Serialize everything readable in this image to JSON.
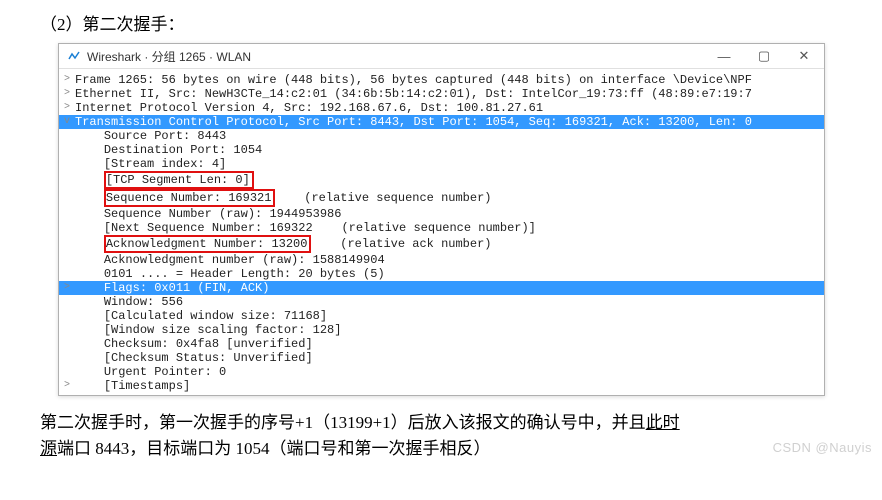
{
  "doc": {
    "header": "（2）第二次握手：",
    "footer_p1_a": "    第二次握手时，第一次握手的序号+1（13199+1）后放入该报文的确认号中，并且",
    "footer_p1_b": "此时",
    "footer_p2_a": "源",
    "footer_p2_b": "端口 8443，目标端口为 1054（端口号和第一次握手相反）"
  },
  "watermark": "CSDN @Nauyis",
  "titlebar": {
    "app": "Wireshark · 分组 1265 · WLAN",
    "min": "—",
    "max": "▢",
    "close": "✕"
  },
  "tree": [
    {
      "g": ">",
      "i": "",
      "t": "Frame 1265: 56 bytes on wire (448 bits), 56 bytes captured (448 bits) on interface \\Device\\NPF",
      "hl": false
    },
    {
      "g": ">",
      "i": "",
      "t": "Ethernet II, Src: NewH3CTe_14:c2:01 (34:6b:5b:14:c2:01), Dst: IntelCor_19:73:ff (48:89:e7:19:7",
      "hl": false
    },
    {
      "g": ">",
      "i": "",
      "t": "Internet Protocol Version 4, Src: 192.168.67.6, Dst: 100.81.27.61",
      "hl": false
    },
    {
      "g": "v",
      "i": "",
      "t": "Transmission Control Protocol, Src Port: 8443, Dst Port: 1054, Seq: 169321, Ack: 13200, Len: 0",
      "hl": true
    },
    {
      "g": "",
      "i": "    ",
      "t": "Source Port: 8443",
      "hl": false
    },
    {
      "g": "",
      "i": "    ",
      "t": "Destination Port: 1054",
      "hl": false
    },
    {
      "g": "",
      "i": "    ",
      "t": "[Stream index: 4]",
      "hl": false
    },
    {
      "g": "",
      "i": "    ",
      "t": "[TCP Segment Len: 0]",
      "hl": false,
      "box": true
    },
    {
      "g": "",
      "i": "    ",
      "t": "Sequence Number: 169321",
      "hl": false,
      "box": true,
      "after": "    (relative sequence number)"
    },
    {
      "g": "",
      "i": "    ",
      "t": "Sequence Number (raw): 1944953986",
      "hl": false
    },
    {
      "g": "",
      "i": "    ",
      "t": "[Next Sequence Number: 169322    (relative sequence number)]",
      "hl": false
    },
    {
      "g": "",
      "i": "    ",
      "t": "Acknowledgment Number: 13200",
      "hl": false,
      "box": true,
      "after": "    (relative ack number)"
    },
    {
      "g": "",
      "i": "    ",
      "t": "Acknowledgment number (raw): 1588149904",
      "hl": false
    },
    {
      "g": "",
      "i": "    ",
      "t": "0101 .... = Header Length: 20 bytes (5)",
      "hl": false
    },
    {
      "g": ">",
      "i": "    ",
      "t": "Flags: 0x011 (FIN, ACK)",
      "hl": true
    },
    {
      "g": "",
      "i": "    ",
      "t": "Window: 556",
      "hl": false
    },
    {
      "g": "",
      "i": "    ",
      "t": "[Calculated window size: 71168]",
      "hl": false
    },
    {
      "g": "",
      "i": "    ",
      "t": "[Window size scaling factor: 128]",
      "hl": false
    },
    {
      "g": "",
      "i": "    ",
      "t": "Checksum: 0x4fa8 [unverified]",
      "hl": false
    },
    {
      "g": "",
      "i": "    ",
      "t": "[Checksum Status: Unverified]",
      "hl": false
    },
    {
      "g": "",
      "i": "    ",
      "t": "Urgent Pointer: 0",
      "hl": false
    },
    {
      "g": ">",
      "i": "    ",
      "t": "[Timestamps]",
      "hl": false
    }
  ]
}
